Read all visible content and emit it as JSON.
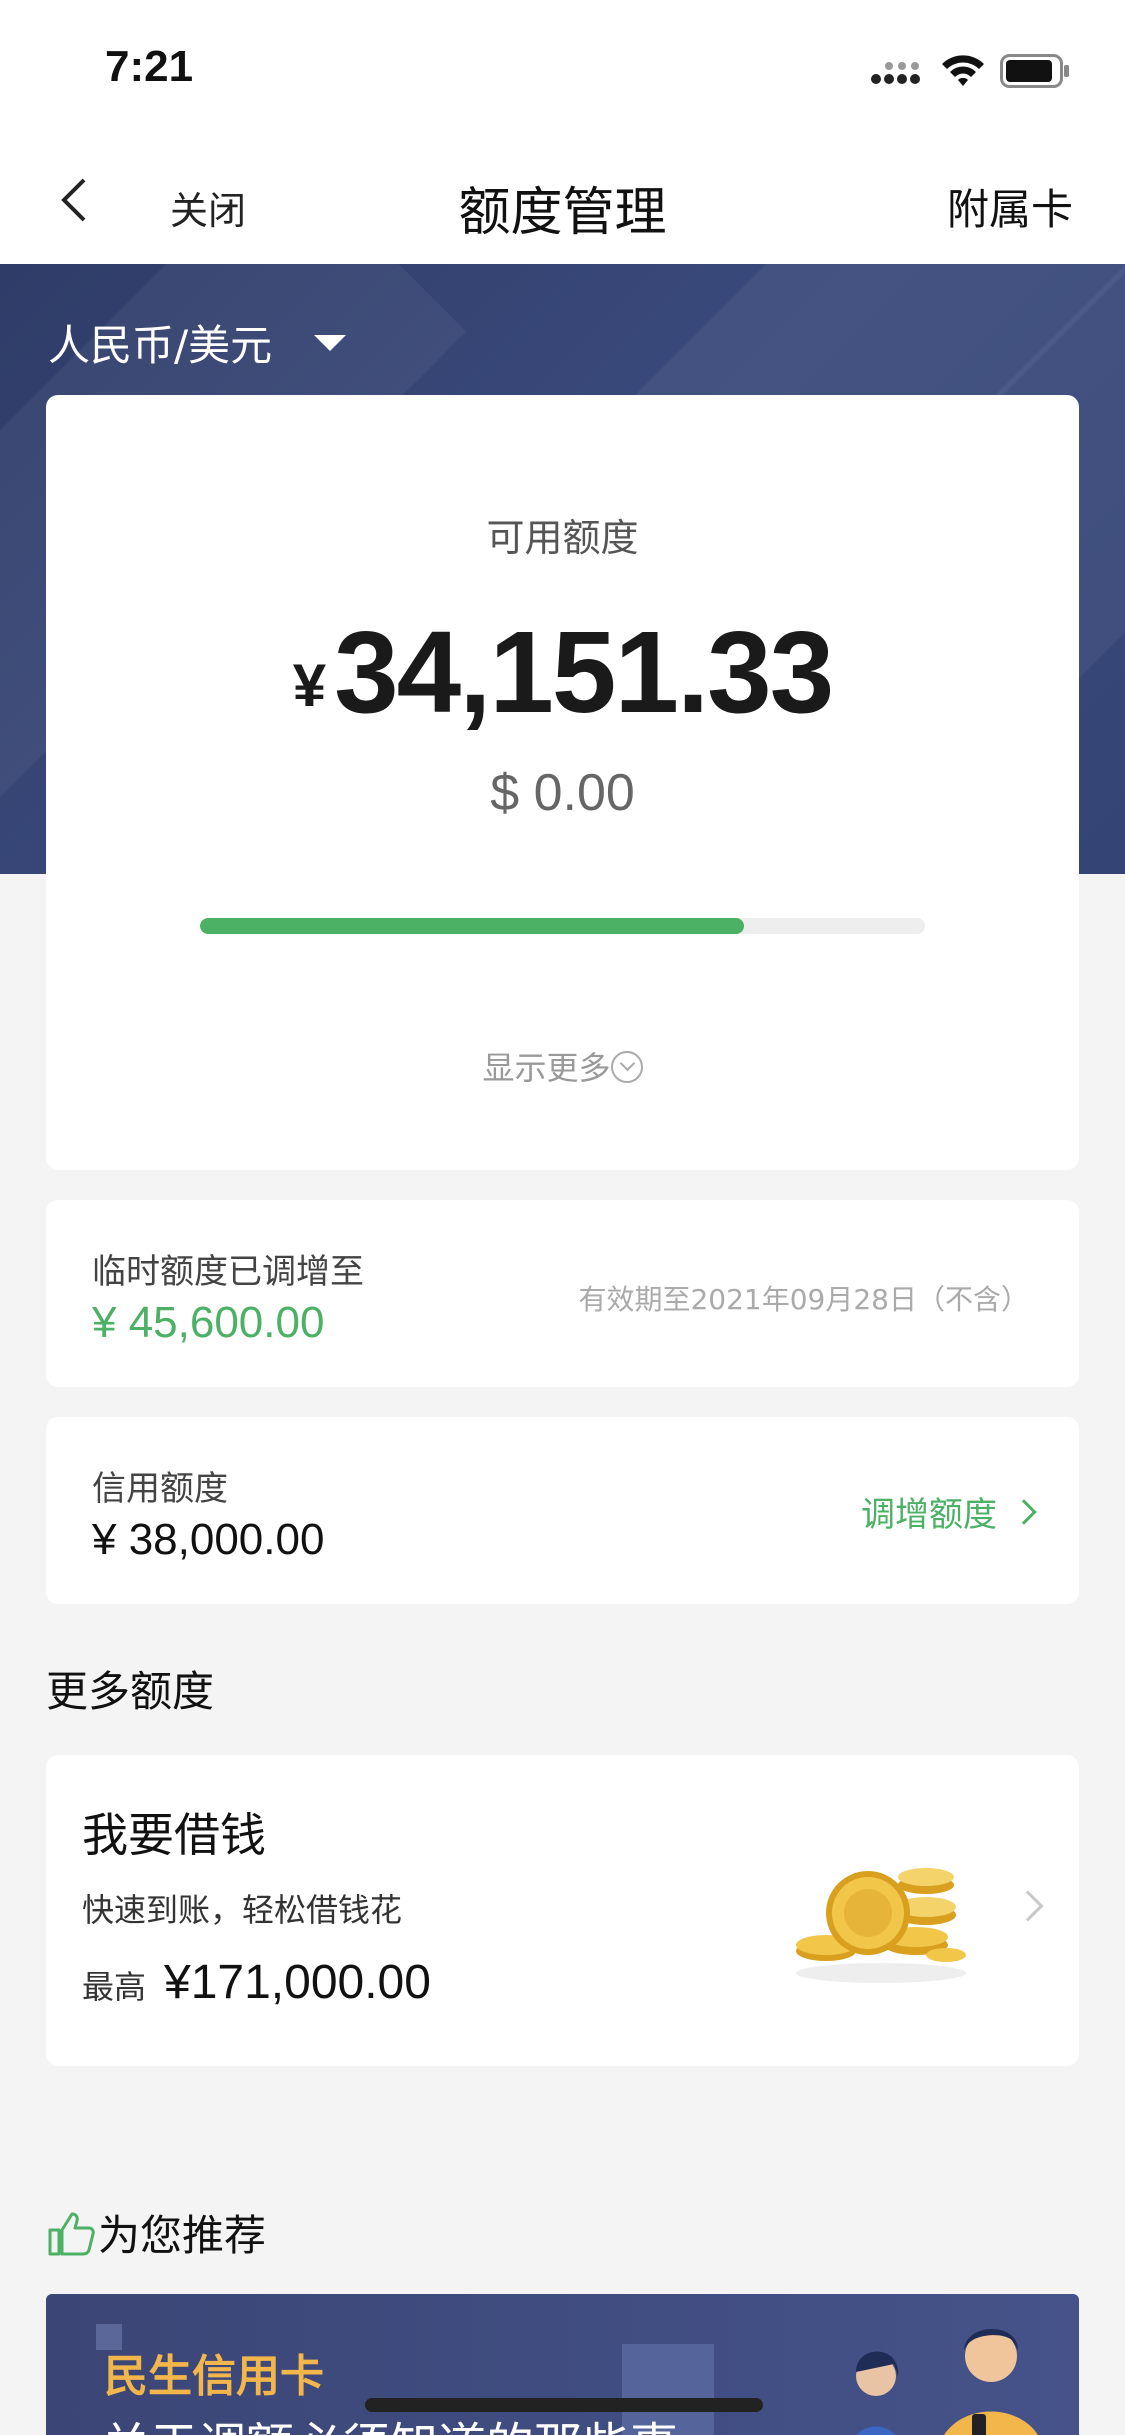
{
  "status_bar": {
    "time": "7:21"
  },
  "nav": {
    "close_label": "关闭",
    "title": "额度管理",
    "right_label": "附属卡"
  },
  "currency_selector": {
    "label": "人民币/美元"
  },
  "available": {
    "label": "可用额度",
    "currency_symbol": "¥",
    "amount": "34,151.33",
    "usd_amount": "$ 0.00",
    "usage_fraction": 0.75,
    "show_more": "显示更多"
  },
  "temporary": {
    "label": "临时额度已调增至",
    "amount": "¥ 45,600.00",
    "validity": "有效期至2021年09月28日（不含）"
  },
  "credit": {
    "label": "信用额度",
    "amount": "¥ 38,000.00",
    "increase_label": "调增额度"
  },
  "more_section": {
    "title": "更多额度"
  },
  "loan": {
    "title": "我要借钱",
    "subtitle": "快速到账，轻松借钱花",
    "max_label": "最高",
    "max_amount": "¥171,000.00"
  },
  "recommend": {
    "title": "为您推荐"
  },
  "banner": {
    "brand": "民生信用卡",
    "text": "关于调额必须知道的那些事"
  },
  "colors": {
    "accent": "#4cb065",
    "hero": "#34426f",
    "banner_brand": "#f2b64b"
  },
  "icons": [
    "back-arrow-icon",
    "signal-icon",
    "wifi-icon",
    "battery-icon",
    "caret-down-icon",
    "chevron-down-circle-icon",
    "chevron-right-icon",
    "coins-icon",
    "thumbs-up-icon"
  ]
}
